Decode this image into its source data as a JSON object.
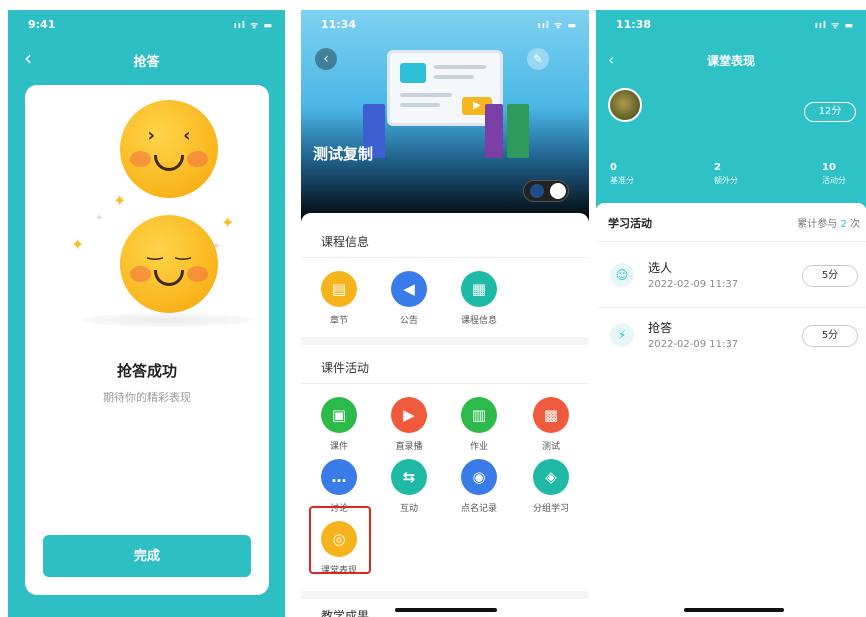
{
  "phone1": {
    "status": {
      "time": "9:41",
      "signal": "ııl ᯤ ▬"
    },
    "header": {
      "back_icon": "‹",
      "title": "抢答"
    },
    "result": {
      "title": "抢答成功",
      "subtitle": "期待你的精彩表现"
    },
    "done_button": "完成",
    "colors": {
      "accent": "#2dbfc4",
      "smiley": "#f9b41c",
      "spark": "#f6c022"
    }
  },
  "phone2": {
    "status": {
      "time": "11:34",
      "signal": "ııl ᯤ ▬"
    },
    "header": {
      "back_icon": "‹",
      "compass_icon": "✎"
    },
    "course_title": "测试复制",
    "sections": [
      {
        "title": "课程信息",
        "items": [
          {
            "label": "章节",
            "icon": "▤",
            "color": "#f5b31c"
          },
          {
            "label": "公告",
            "icon": "◀",
            "color": "#3a7bea"
          },
          {
            "label": "课程信息",
            "icon": "▦",
            "color": "#1fb9a8"
          }
        ]
      },
      {
        "title": "课件活动",
        "items": [
          {
            "label": "课件",
            "icon": "▣",
            "color": "#2cbb4a"
          },
          {
            "label": "直录播",
            "icon": "▶",
            "color": "#ef5a3c"
          },
          {
            "label": "作业",
            "icon": "▥",
            "color": "#2cbb4a"
          },
          {
            "label": "测试",
            "icon": "▩",
            "color": "#ef5a3c"
          },
          {
            "label": "讨论",
            "icon": "…",
            "color": "#3a7bea"
          },
          {
            "label": "互动",
            "icon": "⇆",
            "color": "#1fb9a8"
          },
          {
            "label": "点名记录",
            "icon": "◉",
            "color": "#3a7bea"
          },
          {
            "label": "分组学习",
            "icon": "◈",
            "color": "#1fb9a8"
          },
          {
            "label": "课堂表现",
            "icon": "◎",
            "color": "#f5b31c"
          }
        ]
      },
      {
        "title": "教学成果",
        "items": []
      }
    ]
  },
  "phone3": {
    "status": {
      "time": "11:38",
      "signal": "ııl ᯤ ▬"
    },
    "header": {
      "back_icon": "‹",
      "title": "课堂表现"
    },
    "score_pill": "12分",
    "stats": [
      {
        "value": "0",
        "label": "基准分"
      },
      {
        "value": "2",
        "label": "额外分"
      },
      {
        "value": "10",
        "label": "活动分"
      }
    ],
    "activity": {
      "title": "学习活动",
      "count_prefix": "累计参与",
      "count": "2",
      "count_suffix": "次",
      "rows": [
        {
          "name": "选人",
          "date": "2022-02-09 11:37",
          "points": "5分",
          "icon": "☺"
        },
        {
          "name": "抢答",
          "date": "2022-02-09 11:37",
          "points": "5分",
          "icon": "⚡"
        }
      ]
    }
  }
}
